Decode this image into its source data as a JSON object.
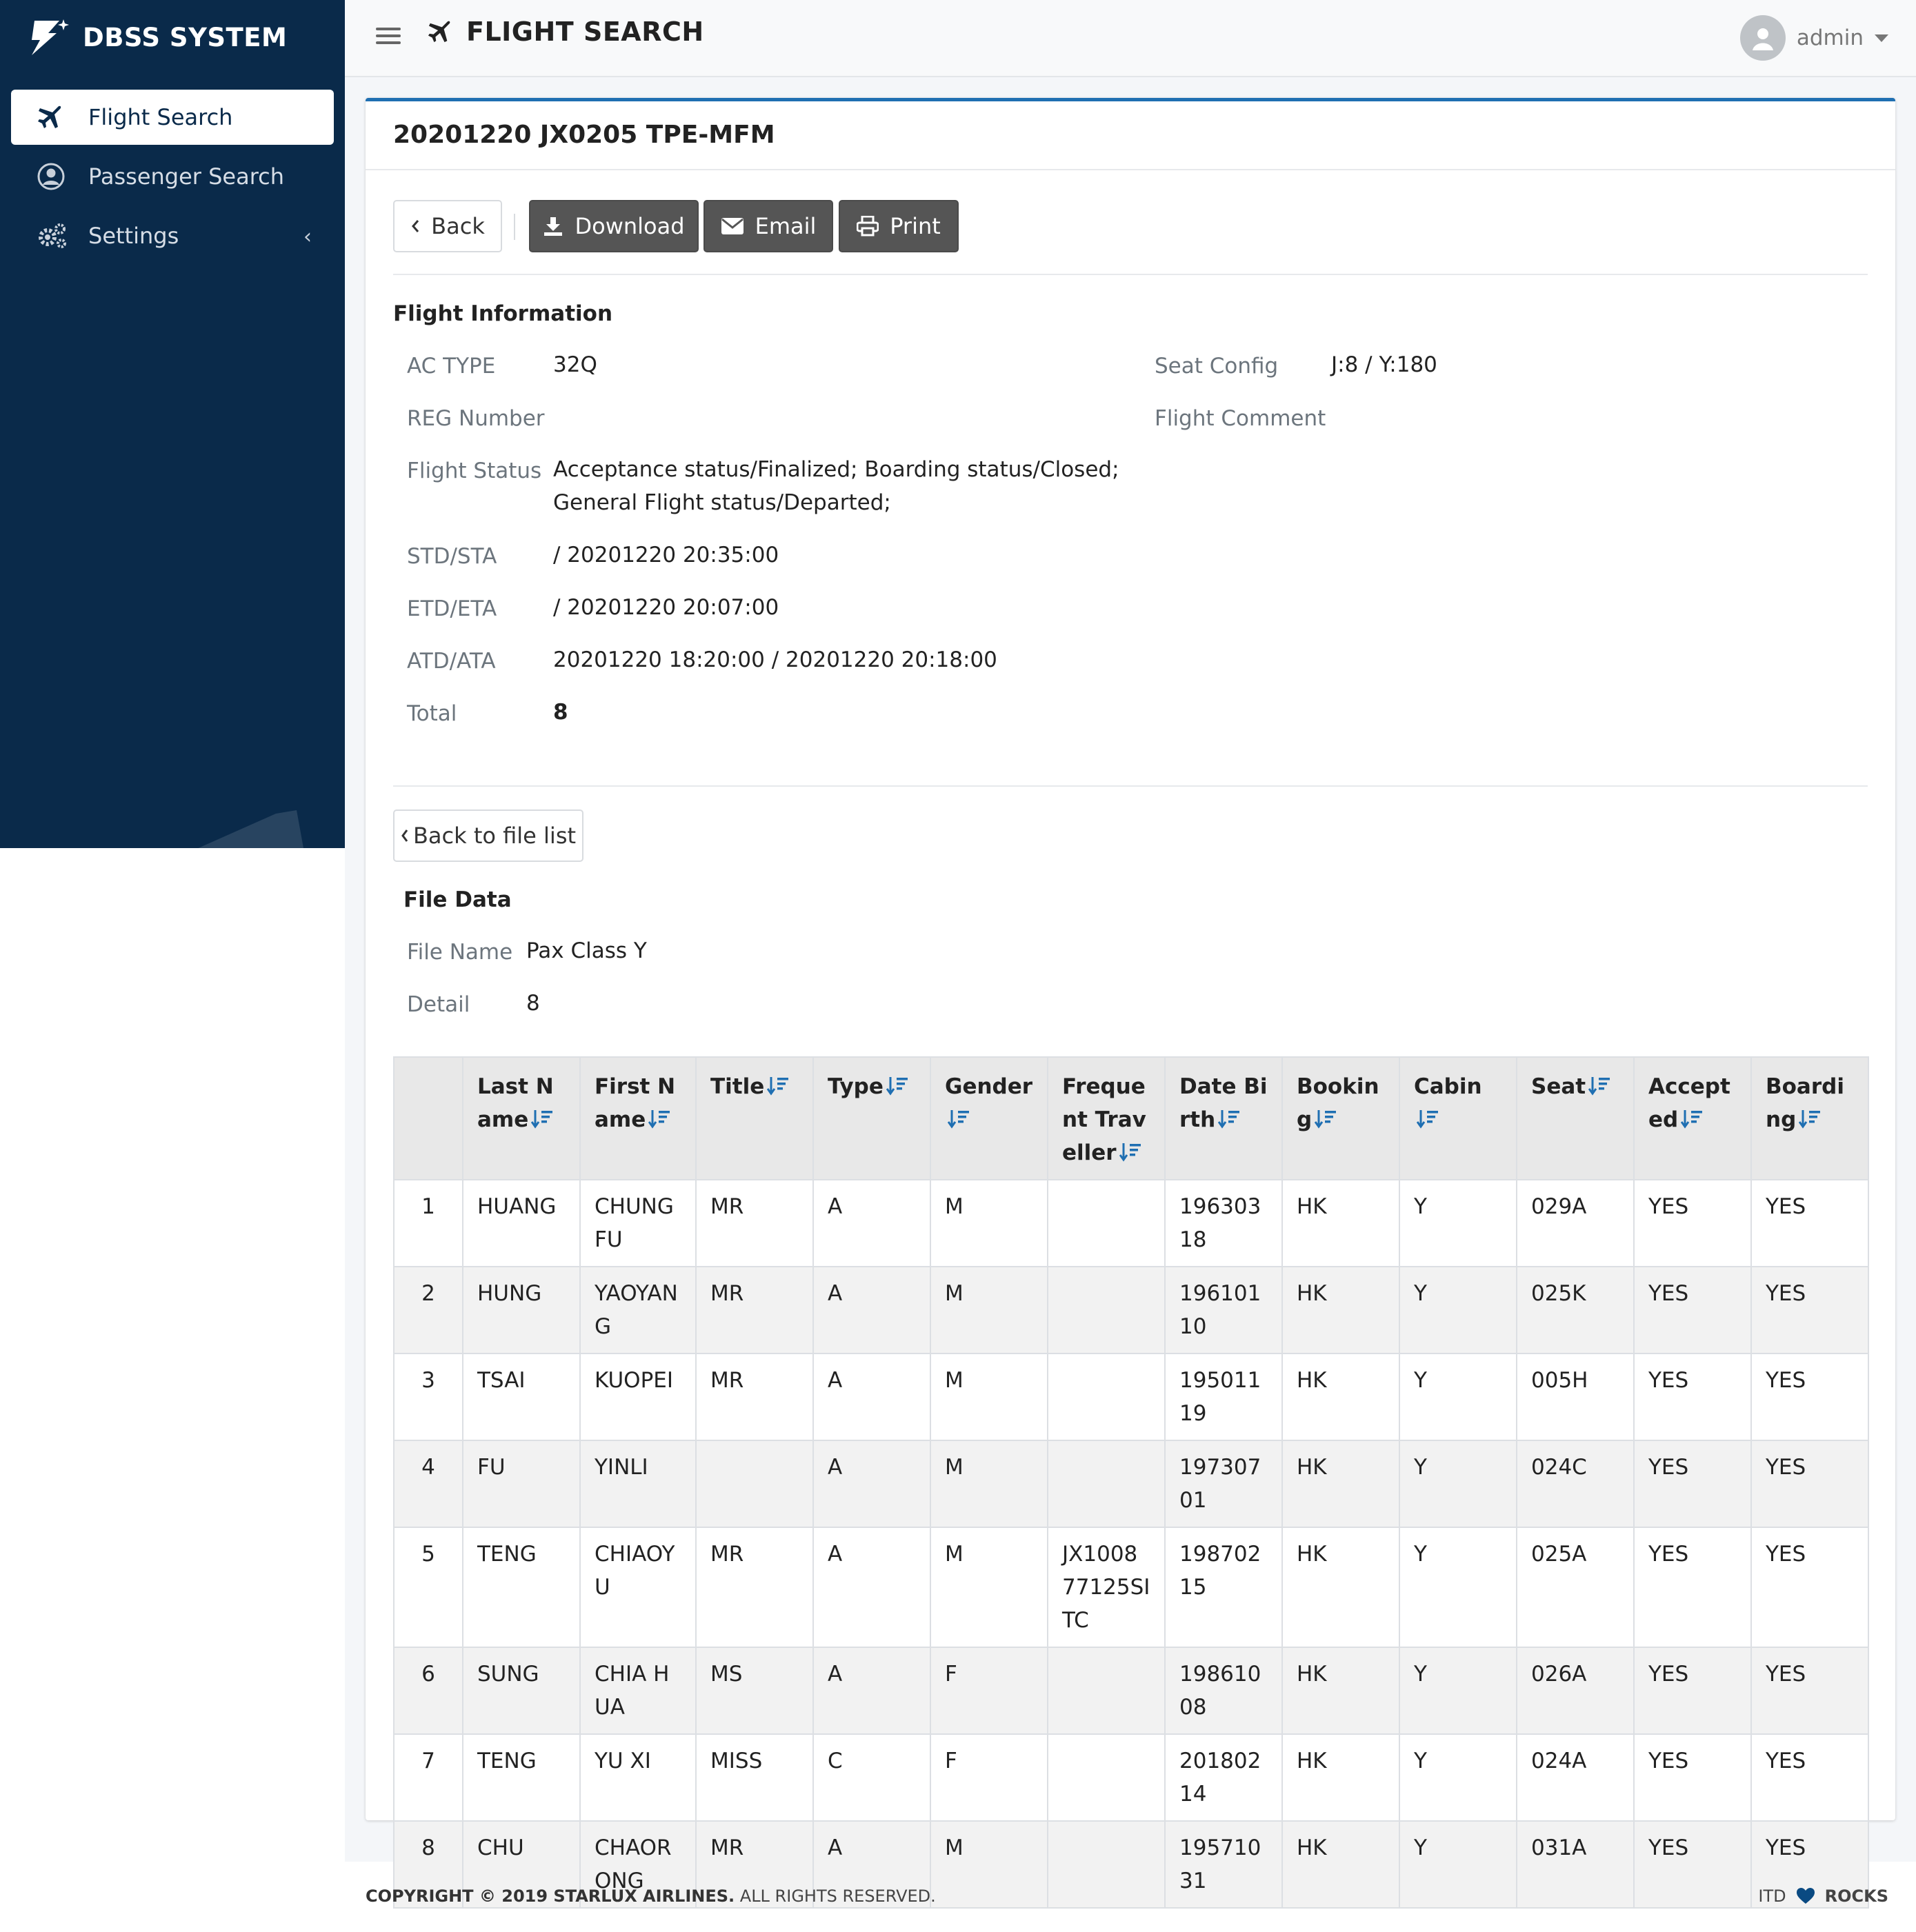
{
  "brand": {
    "name": "DBSS SYSTEM"
  },
  "sidebar": {
    "items": [
      {
        "label": "Flight Search",
        "icon": "plane-icon",
        "active": true
      },
      {
        "label": "Passenger Search",
        "icon": "user-circle-icon",
        "active": false
      },
      {
        "label": "Settings",
        "icon": "gears-icon",
        "active": false
      }
    ]
  },
  "header": {
    "title": "FLIGHT SEARCH",
    "user": "admin"
  },
  "card": {
    "title": "20201220 JX0205 TPE-MFM",
    "buttons": {
      "back": "Back",
      "download": "Download",
      "email": "Email",
      "print": "Print"
    }
  },
  "flight_info": {
    "heading": "Flight Information",
    "ac_type_label": "AC TYPE",
    "ac_type": "32Q",
    "reg_label": "REG Number",
    "reg": "",
    "status_label": "Flight Status",
    "status_line1": "Acceptance status/Finalized; Boarding status/Closed;",
    "status_line2": "General Flight status/Departed;",
    "std_label": "STD/STA",
    "std": "/ 20201220 20:35:00",
    "etd_label": "ETD/ETA",
    "etd": "/ 20201220 20:07:00",
    "atd_label": "ATD/ATA",
    "atd": "20201220 18:20:00 / 20201220 20:18:00",
    "total_label": "Total",
    "total": "8",
    "seat_label": "Seat Config",
    "seat": "J:8 / Y:180",
    "comment_label": "Flight Comment",
    "comment": ""
  },
  "file": {
    "back_label": "Back to file list",
    "heading": "File Data",
    "name_label": "File Name",
    "name": "Pax Class Y",
    "detail_label": "Detail",
    "detail": "8"
  },
  "table": {
    "headers": [
      "",
      "Last Name",
      "First Name",
      "Title",
      "Type",
      "Gender",
      "Frequent Traveller",
      "Date Birth",
      "Booking",
      "Cabin",
      "Seat",
      "Accepted",
      "Boarding"
    ],
    "rows": [
      [
        "1",
        "HUANG",
        "CHUNGFU",
        "MR",
        "A",
        "M",
        "",
        "19630318",
        "HK",
        "Y",
        "029A",
        "YES",
        "YES"
      ],
      [
        "2",
        "HUNG",
        "YAOYANG",
        "MR",
        "A",
        "M",
        "",
        "19610110",
        "HK",
        "Y",
        "025K",
        "YES",
        "YES"
      ],
      [
        "3",
        "TSAI",
        "KUOPEI",
        "MR",
        "A",
        "M",
        "",
        "19501119",
        "HK",
        "Y",
        "005H",
        "YES",
        "YES"
      ],
      [
        "4",
        "FU",
        "YINLI",
        "",
        "A",
        "M",
        "",
        "19730701",
        "HK",
        "Y",
        "024C",
        "YES",
        "YES"
      ],
      [
        "5",
        "TENG",
        "CHIAOYU",
        "MR",
        "A",
        "M",
        "JX100877125SITC",
        "19870215",
        "HK",
        "Y",
        "025A",
        "YES",
        "YES"
      ],
      [
        "6",
        "SUNG",
        "CHIA HUA",
        "MS",
        "A",
        "F",
        "",
        "19861008",
        "HK",
        "Y",
        "026A",
        "YES",
        "YES"
      ],
      [
        "7",
        "TENG",
        "YU XI",
        "MISS",
        "C",
        "F",
        "",
        "20180214",
        "HK",
        "Y",
        "024A",
        "YES",
        "YES"
      ],
      [
        "8",
        "CHU",
        "CHAORONG",
        "MR",
        "A",
        "M",
        "",
        "19571031",
        "HK",
        "Y",
        "031A",
        "YES",
        "YES"
      ]
    ]
  },
  "footer": {
    "copyright": "COPYRIGHT © 2019 STARLUX AIRLINES.",
    "rights": " ALL RIGHTS RESERVED.",
    "left_word": "ITD",
    "right_word": "ROCKS"
  },
  "colors": {
    "sidebar": "#0a2a4a",
    "accent": "#1f6fb2",
    "dark_button": "#555555"
  }
}
